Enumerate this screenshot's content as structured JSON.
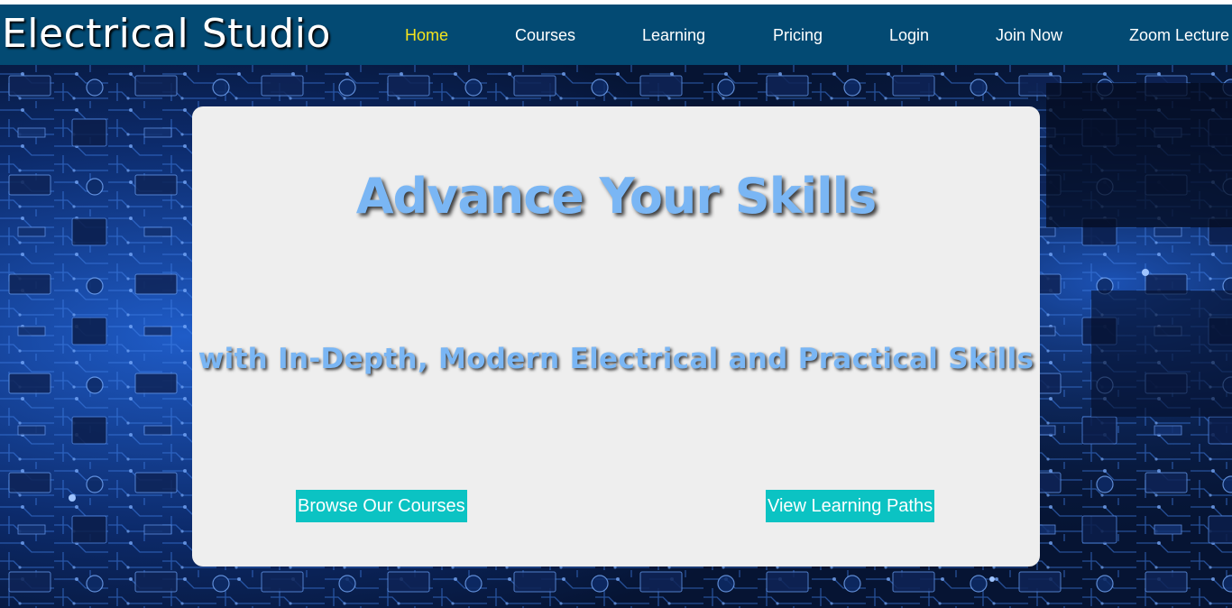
{
  "brand": {
    "name": "Electrical Studio"
  },
  "nav": {
    "items": [
      {
        "label": "Home",
        "active": true
      },
      {
        "label": "Courses",
        "active": false
      },
      {
        "label": "Learning",
        "active": false
      },
      {
        "label": "Pricing",
        "active": false
      },
      {
        "label": "Login",
        "active": false
      },
      {
        "label": "Join Now",
        "active": false
      },
      {
        "label": "Zoom Lecture",
        "active": false
      }
    ],
    "background_color": "#034a73",
    "active_color": "#f5e31d"
  },
  "hero": {
    "background": "circuit-board-image",
    "headline": "Advance Your Skills",
    "subheadline": "with In-Depth, Modern Electrical and Practical Skills",
    "text_color": "#7ab6f4",
    "buttons": {
      "browse_label": "Browse Our Courses",
      "paths_label": "View Learning Paths",
      "color": "#0bc3c3"
    }
  }
}
